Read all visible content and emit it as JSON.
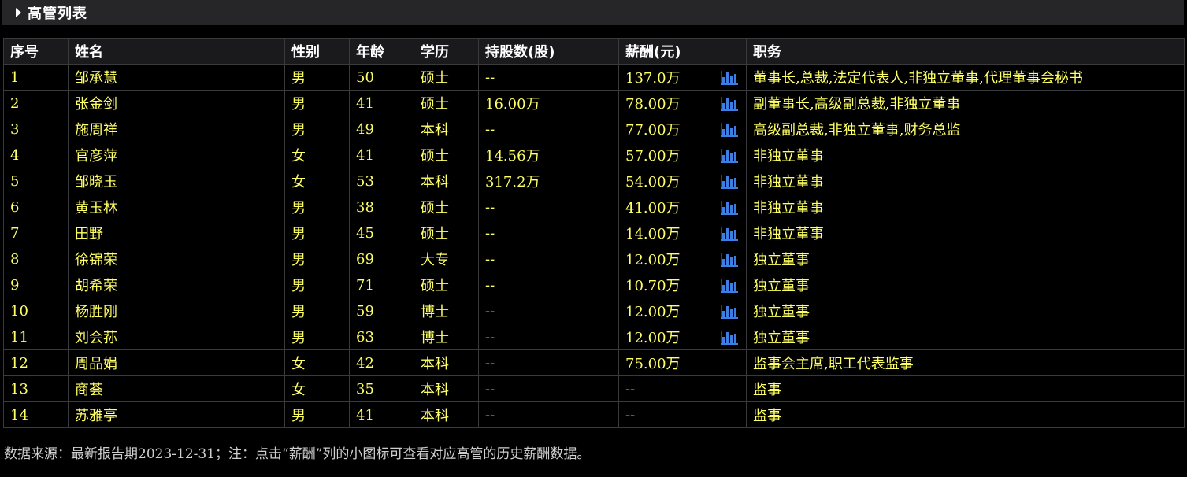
{
  "section": {
    "title": "高管列表"
  },
  "table": {
    "headers": [
      "序号",
      "姓名",
      "性别",
      "年龄",
      "学历",
      "持股数(股)",
      "薪酬(元)",
      "职务"
    ],
    "rows": [
      {
        "no": "1",
        "name": "邹承慧",
        "gender": "男",
        "age": "50",
        "edu": "硕士",
        "shares": "--",
        "salary": "137.0万",
        "salary_chart": true,
        "position": "董事长,总裁,法定代表人,非独立董事,代理董事会秘书"
      },
      {
        "no": "2",
        "name": "张金剑",
        "gender": "男",
        "age": "41",
        "edu": "硕士",
        "shares": "16.00万",
        "salary": "78.00万",
        "salary_chart": true,
        "position": "副董事长,高级副总裁,非独立董事"
      },
      {
        "no": "3",
        "name": "施周祥",
        "gender": "男",
        "age": "49",
        "edu": "本科",
        "shares": "--",
        "salary": "77.00万",
        "salary_chart": true,
        "position": "高级副总裁,非独立董事,财务总监"
      },
      {
        "no": "4",
        "name": "官彦萍",
        "gender": "女",
        "age": "41",
        "edu": "硕士",
        "shares": "14.56万",
        "salary": "57.00万",
        "salary_chart": true,
        "position": "非独立董事"
      },
      {
        "no": "5",
        "name": "邹晓玉",
        "gender": "女",
        "age": "53",
        "edu": "本科",
        "shares": "317.2万",
        "salary": "54.00万",
        "salary_chart": true,
        "position": "非独立董事"
      },
      {
        "no": "6",
        "name": "黄玉林",
        "gender": "男",
        "age": "38",
        "edu": "硕士",
        "shares": "--",
        "salary": "41.00万",
        "salary_chart": true,
        "position": "非独立董事"
      },
      {
        "no": "7",
        "name": "田野",
        "gender": "男",
        "age": "45",
        "edu": "硕士",
        "shares": "--",
        "salary": "14.00万",
        "salary_chart": true,
        "position": "非独立董事"
      },
      {
        "no": "8",
        "name": "徐锦荣",
        "gender": "男",
        "age": "69",
        "edu": "大专",
        "shares": "--",
        "salary": "12.00万",
        "salary_chart": true,
        "position": "独立董事"
      },
      {
        "no": "9",
        "name": "胡希荣",
        "gender": "男",
        "age": "71",
        "edu": "硕士",
        "shares": "--",
        "salary": "10.70万",
        "salary_chart": true,
        "position": "独立董事"
      },
      {
        "no": "10",
        "name": "杨胜刚",
        "gender": "男",
        "age": "59",
        "edu": "博士",
        "shares": "--",
        "salary": "12.00万",
        "salary_chart": true,
        "position": "独立董事"
      },
      {
        "no": "11",
        "name": "刘会荪",
        "gender": "男",
        "age": "63",
        "edu": "博士",
        "shares": "--",
        "salary": "12.00万",
        "salary_chart": true,
        "position": "独立董事"
      },
      {
        "no": "12",
        "name": "周品娟",
        "gender": "女",
        "age": "42",
        "edu": "本科",
        "shares": "--",
        "salary": "75.00万",
        "salary_chart": false,
        "position": "监事会主席,职工代表监事"
      },
      {
        "no": "13",
        "name": "商荟",
        "gender": "女",
        "age": "35",
        "edu": "本科",
        "shares": "--",
        "salary": "--",
        "salary_chart": false,
        "position": "监事"
      },
      {
        "no": "14",
        "name": "苏雅亭",
        "gender": "男",
        "age": "41",
        "edu": "本科",
        "shares": "--",
        "salary": "--",
        "salary_chart": false,
        "position": "监事"
      }
    ]
  },
  "footer": {
    "note": "数据来源：最新报告期2023-12-31；注：点击“薪酬”列的小图标可查看对应高管的历史薪酬数据。"
  },
  "icons": {
    "section_toggle": "triangle-right-icon",
    "salary_chart": "bar-chart-icon"
  },
  "colors": {
    "background": "#000000",
    "header_bar": "#262629",
    "cell_text": "#ffff66",
    "header_text": "#ffffff",
    "grid": "#3a3a3a",
    "chart_icon": "#3d7fe0"
  }
}
